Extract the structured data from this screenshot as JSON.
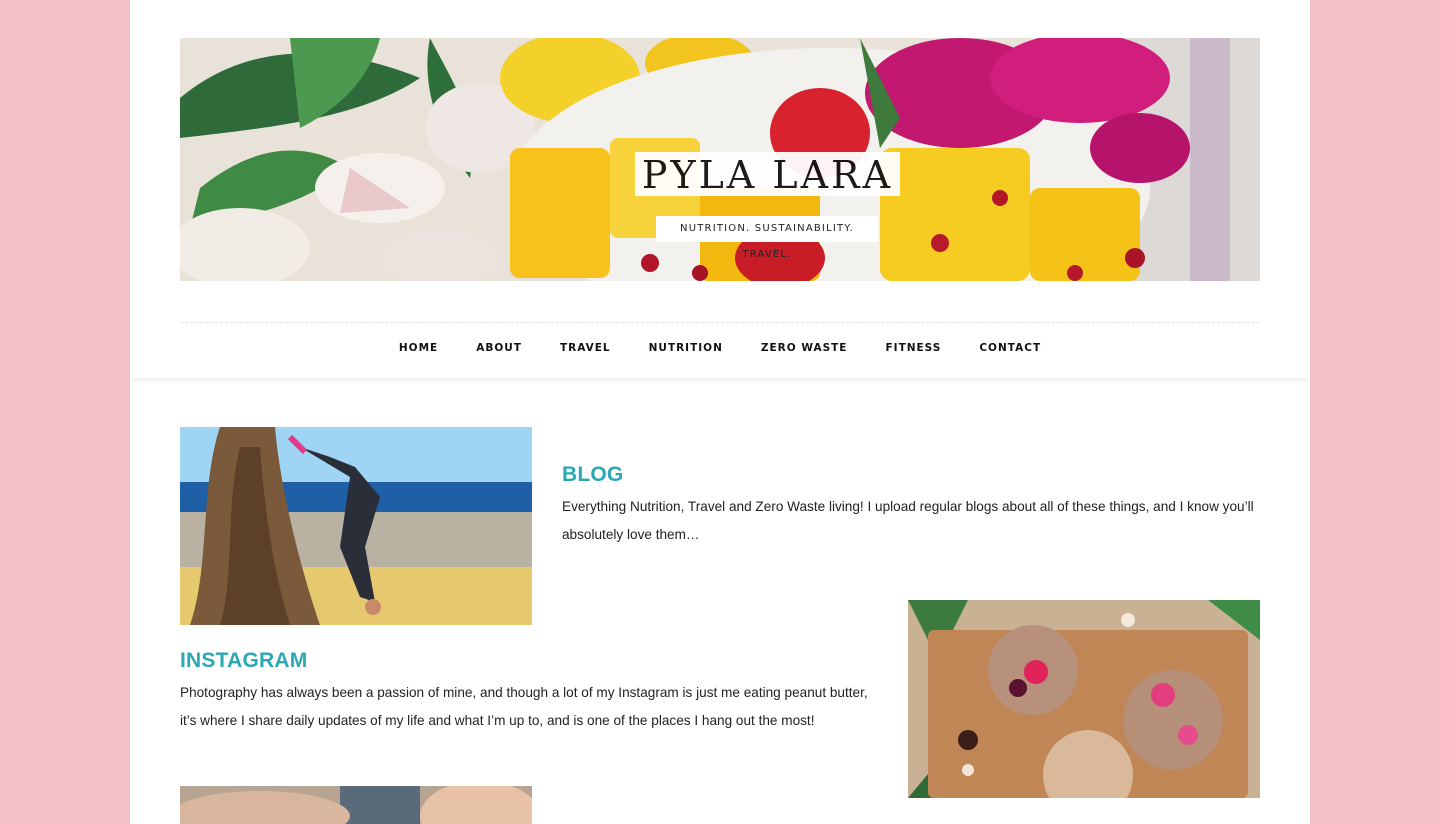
{
  "site": {
    "title": "PYLA LARA",
    "tagline": "NUTRITION. SUSTAINABILITY. TRAVEL."
  },
  "nav": {
    "items": [
      {
        "label": "HOME"
      },
      {
        "label": "ABOUT"
      },
      {
        "label": "TRAVEL"
      },
      {
        "label": "NUTRITION"
      },
      {
        "label": "ZERO WASTE"
      },
      {
        "label": "FITNESS"
      },
      {
        "label": "CONTACT"
      }
    ]
  },
  "sections": [
    {
      "title": "BLOG",
      "text": "Everything Nutrition, Travel and Zero Waste living! I upload regular blogs about all of these things, and I know you’ll absolutely love them…"
    },
    {
      "title": "INSTAGRAM",
      "text": "Photography has always been a passion of mine, and though a lot of my Instagram is just me eating peanut butter, it’s where I share daily updates of my life and what I’m up to, and is one of the places I hang out the most!"
    }
  ],
  "colors": {
    "background": "#f4bfc8",
    "accent": "#2aa9b4",
    "text": "#222222"
  }
}
